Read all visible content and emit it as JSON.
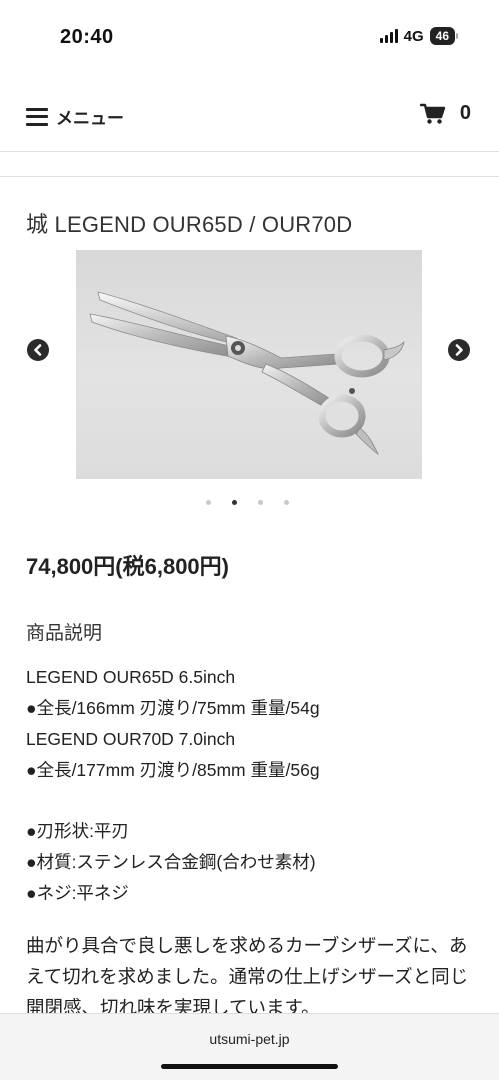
{
  "status_bar": {
    "time": "20:40",
    "network": "4G",
    "battery": "46"
  },
  "header": {
    "menu_label": "メニュー",
    "cart_count": "0",
    "icons": {
      "menu": "hamburger-menu-icon",
      "cart": "shopping-cart-icon"
    }
  },
  "product": {
    "title": "城 LEGEND OUR65D / OUR70D",
    "image": "curved-grooming-scissors",
    "carousel": {
      "slide_count": 4,
      "active_index": 1
    },
    "price": "74,800円(税6,800円)"
  },
  "description": {
    "heading": "商品説明",
    "spec_lines": [
      "LEGEND OUR65D 6.5inch",
      "●全長/166mm 刃渡り/75mm 重量/54g",
      "LEGEND OUR70D 7.0inch",
      "●全長/177mm 刃渡り/85mm 重量/56g"
    ],
    "feature_lines": [
      "●刃形状:平刃",
      "●材質:ステンレス合金鋼(合わせ素材)",
      "●ネジ:平ネジ"
    ],
    "body": "曲がり具合で良し悪しを求めるカーブシザーズに、あえて切れを求めました。通常の仕上げシザーズと同じ開閉感、切れ味を実現しています。"
  },
  "browser": {
    "url": "utsumi-pet.jp"
  },
  "colors": {
    "text": "#222222",
    "divider": "#e2e2e2",
    "slide_background": "#dedede"
  }
}
